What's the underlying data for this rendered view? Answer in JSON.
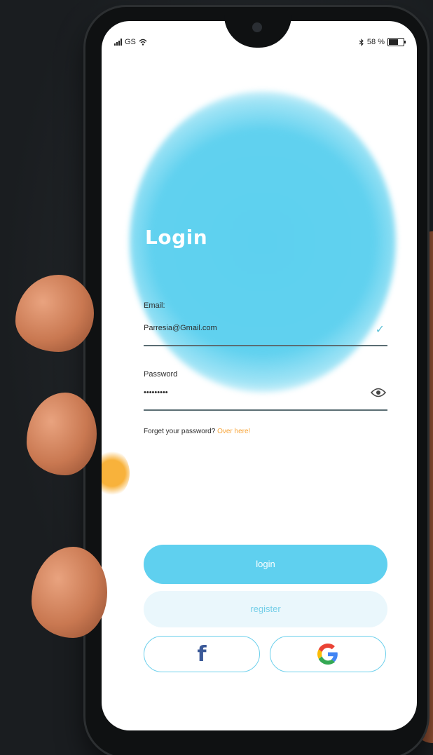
{
  "status_bar": {
    "carrier": "GS",
    "battery_text": "58 %",
    "battery_level": 0.58
  },
  "login": {
    "title": "Login",
    "email_label": "Email:",
    "email_value": "Parresia@Gmail.com",
    "password_label": "Password",
    "password_value": "•••••••••",
    "forgot_text": "Forget your password?",
    "forgot_link": "Over here!",
    "login_button": "login",
    "register_button": "register",
    "facebook_glyph": "f"
  },
  "colors": {
    "accent": "#5fd0ef",
    "register_bg": "#eaf7fc",
    "link": "#f7a53a",
    "facebook": "#3b5998"
  },
  "icons": {
    "signal": "signal-icon",
    "wifi": "wifi-icon",
    "bluetooth": "bluetooth-icon",
    "battery": "battery-icon",
    "check": "check-icon",
    "eye": "eye-icon",
    "facebook": "facebook-icon",
    "google": "google-icon"
  }
}
